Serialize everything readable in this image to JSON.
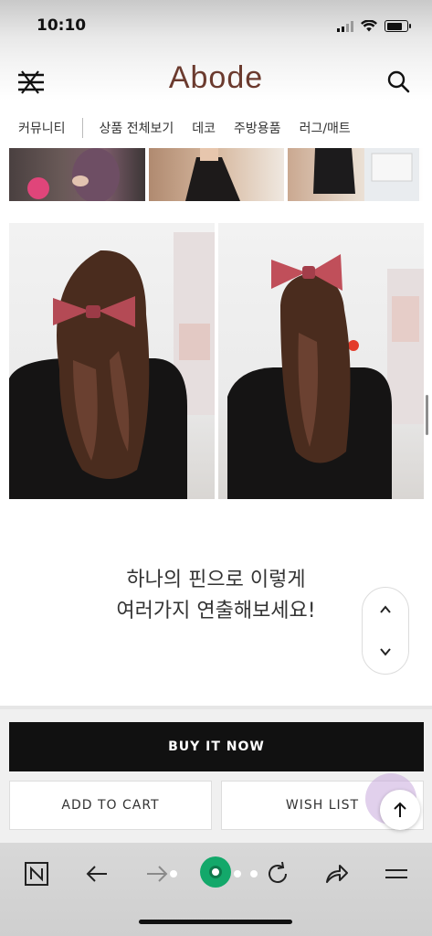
{
  "status_bar": {
    "time": "10:10"
  },
  "header": {
    "logo": "Abode"
  },
  "nav": {
    "tabs": [
      "커뮤니티",
      "상품 전체보기",
      "데코",
      "주방용품",
      "러그/매트"
    ]
  },
  "content": {
    "caption_line1": "하나의 핀으로 이렇게",
    "caption_line2": "여러가지 연출해보세요!"
  },
  "actions": {
    "buy_now": "BUY IT NOW",
    "add_to_cart": "ADD TO CART",
    "wish_list": "WISH LIST"
  },
  "colors": {
    "brand": "#6b3a2e",
    "buy_button": "#111111",
    "browser_accent": "#13a86a"
  },
  "icons": {
    "menu": "hamburger-crossed-icon",
    "search": "search-icon",
    "scroll_up": "chevron-up-icon",
    "scroll_down": "chevron-down-icon",
    "back_to_top": "arrow-up-icon",
    "browser_home": "naver-n-icon",
    "browser_back": "arrow-left-icon",
    "browser_forward": "arrow-right-icon",
    "browser_reload": "reload-icon",
    "browser_share": "share-icon",
    "browser_menu": "menu-icon"
  }
}
